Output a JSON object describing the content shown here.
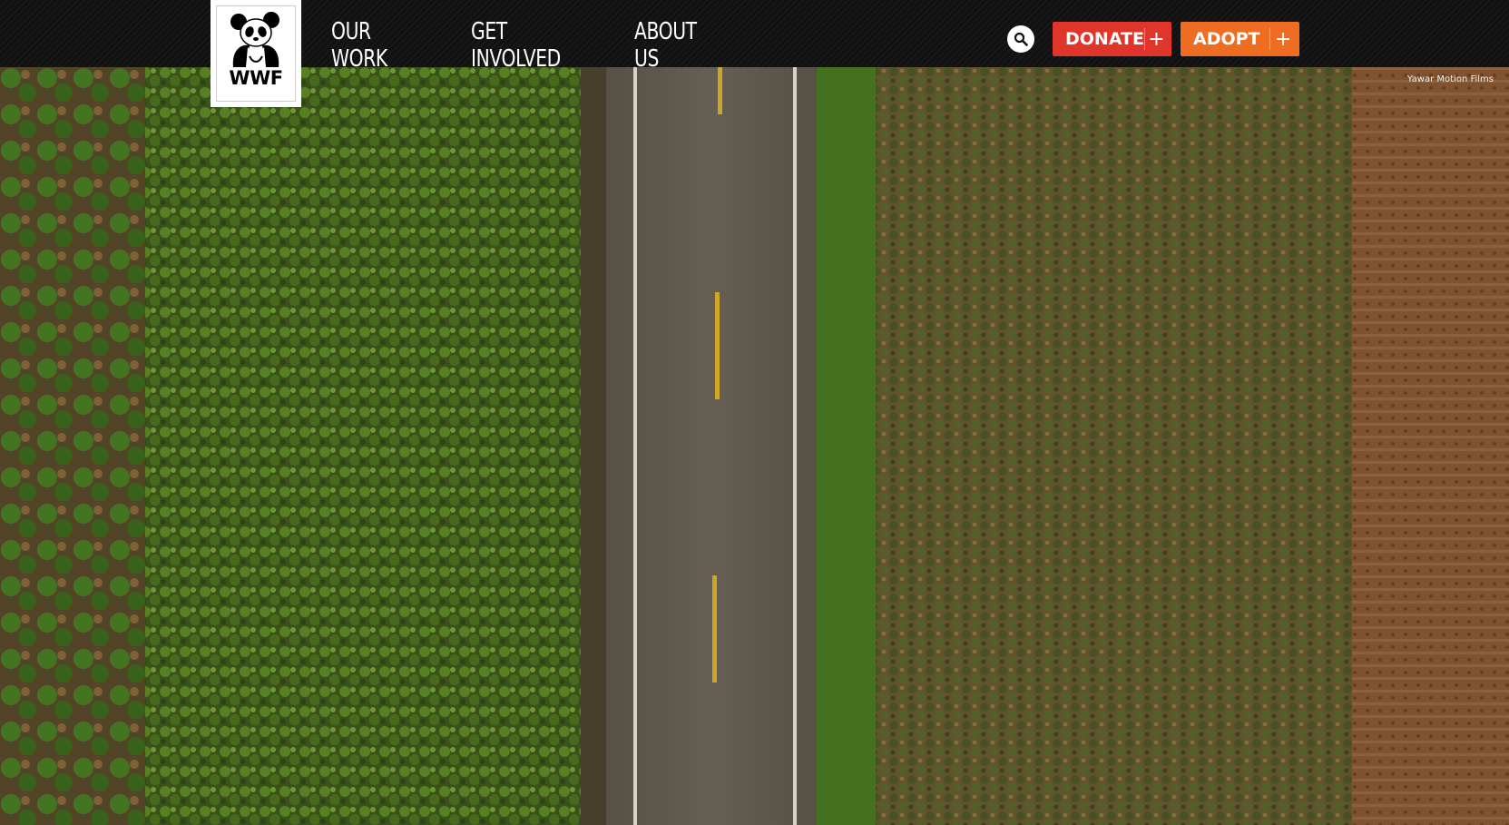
{
  "header": {
    "logo_text": "WWF",
    "nav": [
      {
        "label": "OUR WORK"
      },
      {
        "label": "GET INVOLVED"
      },
      {
        "label": "ABOUT US"
      }
    ],
    "search_icon": "search-icon",
    "donate_label": "DONATE",
    "adopt_label": "ADOPT",
    "plus_glyph": "+"
  },
  "hero": {
    "photo_credit": "Yawar Motion Films",
    "scene": "aerial-road-through-plantation"
  },
  "colors": {
    "header_bg": "#111111",
    "donate": "#e0352b",
    "adopt": "#ef6d22",
    "road": "#6b6356",
    "center_line": "#e1b32a"
  }
}
